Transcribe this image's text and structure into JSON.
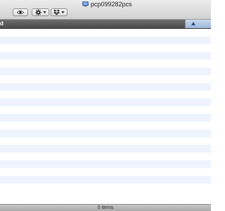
{
  "window": {
    "title": "pcp099282pcs"
  },
  "toolbar": {
    "buttons": [
      {
        "name": "quick-look",
        "icon": "eye-icon"
      },
      {
        "name": "action",
        "icon": "gear-icon",
        "has_menu": true
      },
      {
        "name": "dropbox",
        "icon": "dropbox-icon",
        "has_menu": true
      }
    ]
  },
  "list": {
    "column_label": "d",
    "sort_direction": "ascending",
    "items": []
  },
  "status": {
    "text": "0 items"
  },
  "colors": {
    "header_bg": "#5c5c5c",
    "sort_tab": "#b3c8e6",
    "alt_row": "#eef3fd"
  }
}
